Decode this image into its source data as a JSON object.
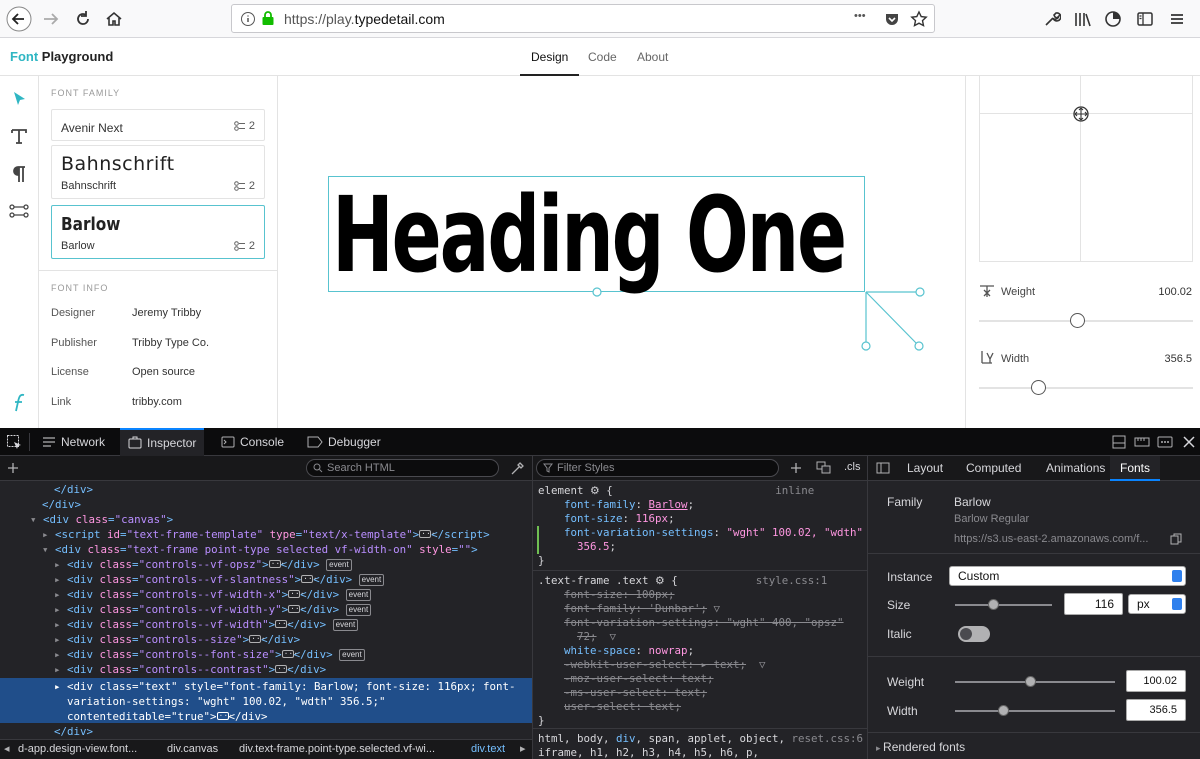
{
  "browser": {
    "url_prefix": "https://play.",
    "url_host": "typedetail.com",
    "more_label": "•••"
  },
  "app": {
    "logo_a": "Font",
    "logo_b": " Playground",
    "tabs": [
      {
        "label": "Design"
      },
      {
        "label": "Code"
      },
      {
        "label": "About"
      }
    ]
  },
  "font_family": {
    "title": "FONT FAMILY",
    "cards": [
      {
        "name": "Avenir Next",
        "count": "2"
      },
      {
        "big": "Bahnschrift",
        "name": "Bahnschrift",
        "count": "2"
      },
      {
        "big": "Barlow",
        "name": "Barlow",
        "count": "2"
      }
    ]
  },
  "font_info": {
    "title": "FONT INFO",
    "rows": [
      {
        "label": "Designer",
        "value": "Jeremy Tribby"
      },
      {
        "label": "Publisher",
        "value": "Tribby Type Co."
      },
      {
        "label": "License",
        "value": "Open source"
      },
      {
        "label": "Link",
        "value": "tribby.com"
      }
    ]
  },
  "canvas": {
    "heading": "Heading One"
  },
  "variables": {
    "weight": {
      "label": "Weight",
      "value": "100.02",
      "fraction": 0.46
    },
    "width": {
      "label": "Width",
      "value": "356.5",
      "fraction": 0.28
    }
  },
  "devtools": {
    "tabs": {
      "network": "Network",
      "inspector": "Inspector",
      "console": "Console",
      "debugger": "Debugger"
    },
    "search_html": "Search HTML",
    "filter_styles": "Filter Styles",
    "cls": ".cls",
    "breadcrumbs": [
      "d-app.design-view.font...",
      "div.canvas",
      "div.text-frame.point-type.selected.vf-wi...",
      "div.text"
    ],
    "side_tabs": [
      "Layout",
      "Computed",
      "Animations",
      "Fonts"
    ],
    "fonts": {
      "family_label": "Family",
      "family": "Barlow",
      "family_sub": "Barlow Regular",
      "url": "https://s3.us-east-2.amazonaws.com/f...",
      "instance_label": "Instance",
      "instance": "Custom",
      "size_label": "Size",
      "size": "116",
      "size_unit": "px",
      "size_fraction": 0.4,
      "italic_label": "Italic",
      "weight_label": "Weight",
      "weight": "100.02",
      "weight_fraction": 0.47,
      "width_label": "Width",
      "width": "356.5",
      "width_fraction": 0.3,
      "rendered": "Rendered fonts"
    }
  },
  "colors": {
    "accent": "#2fb6c3",
    "devtools_bg": "#232327",
    "selected_row": "#204e8a"
  }
}
